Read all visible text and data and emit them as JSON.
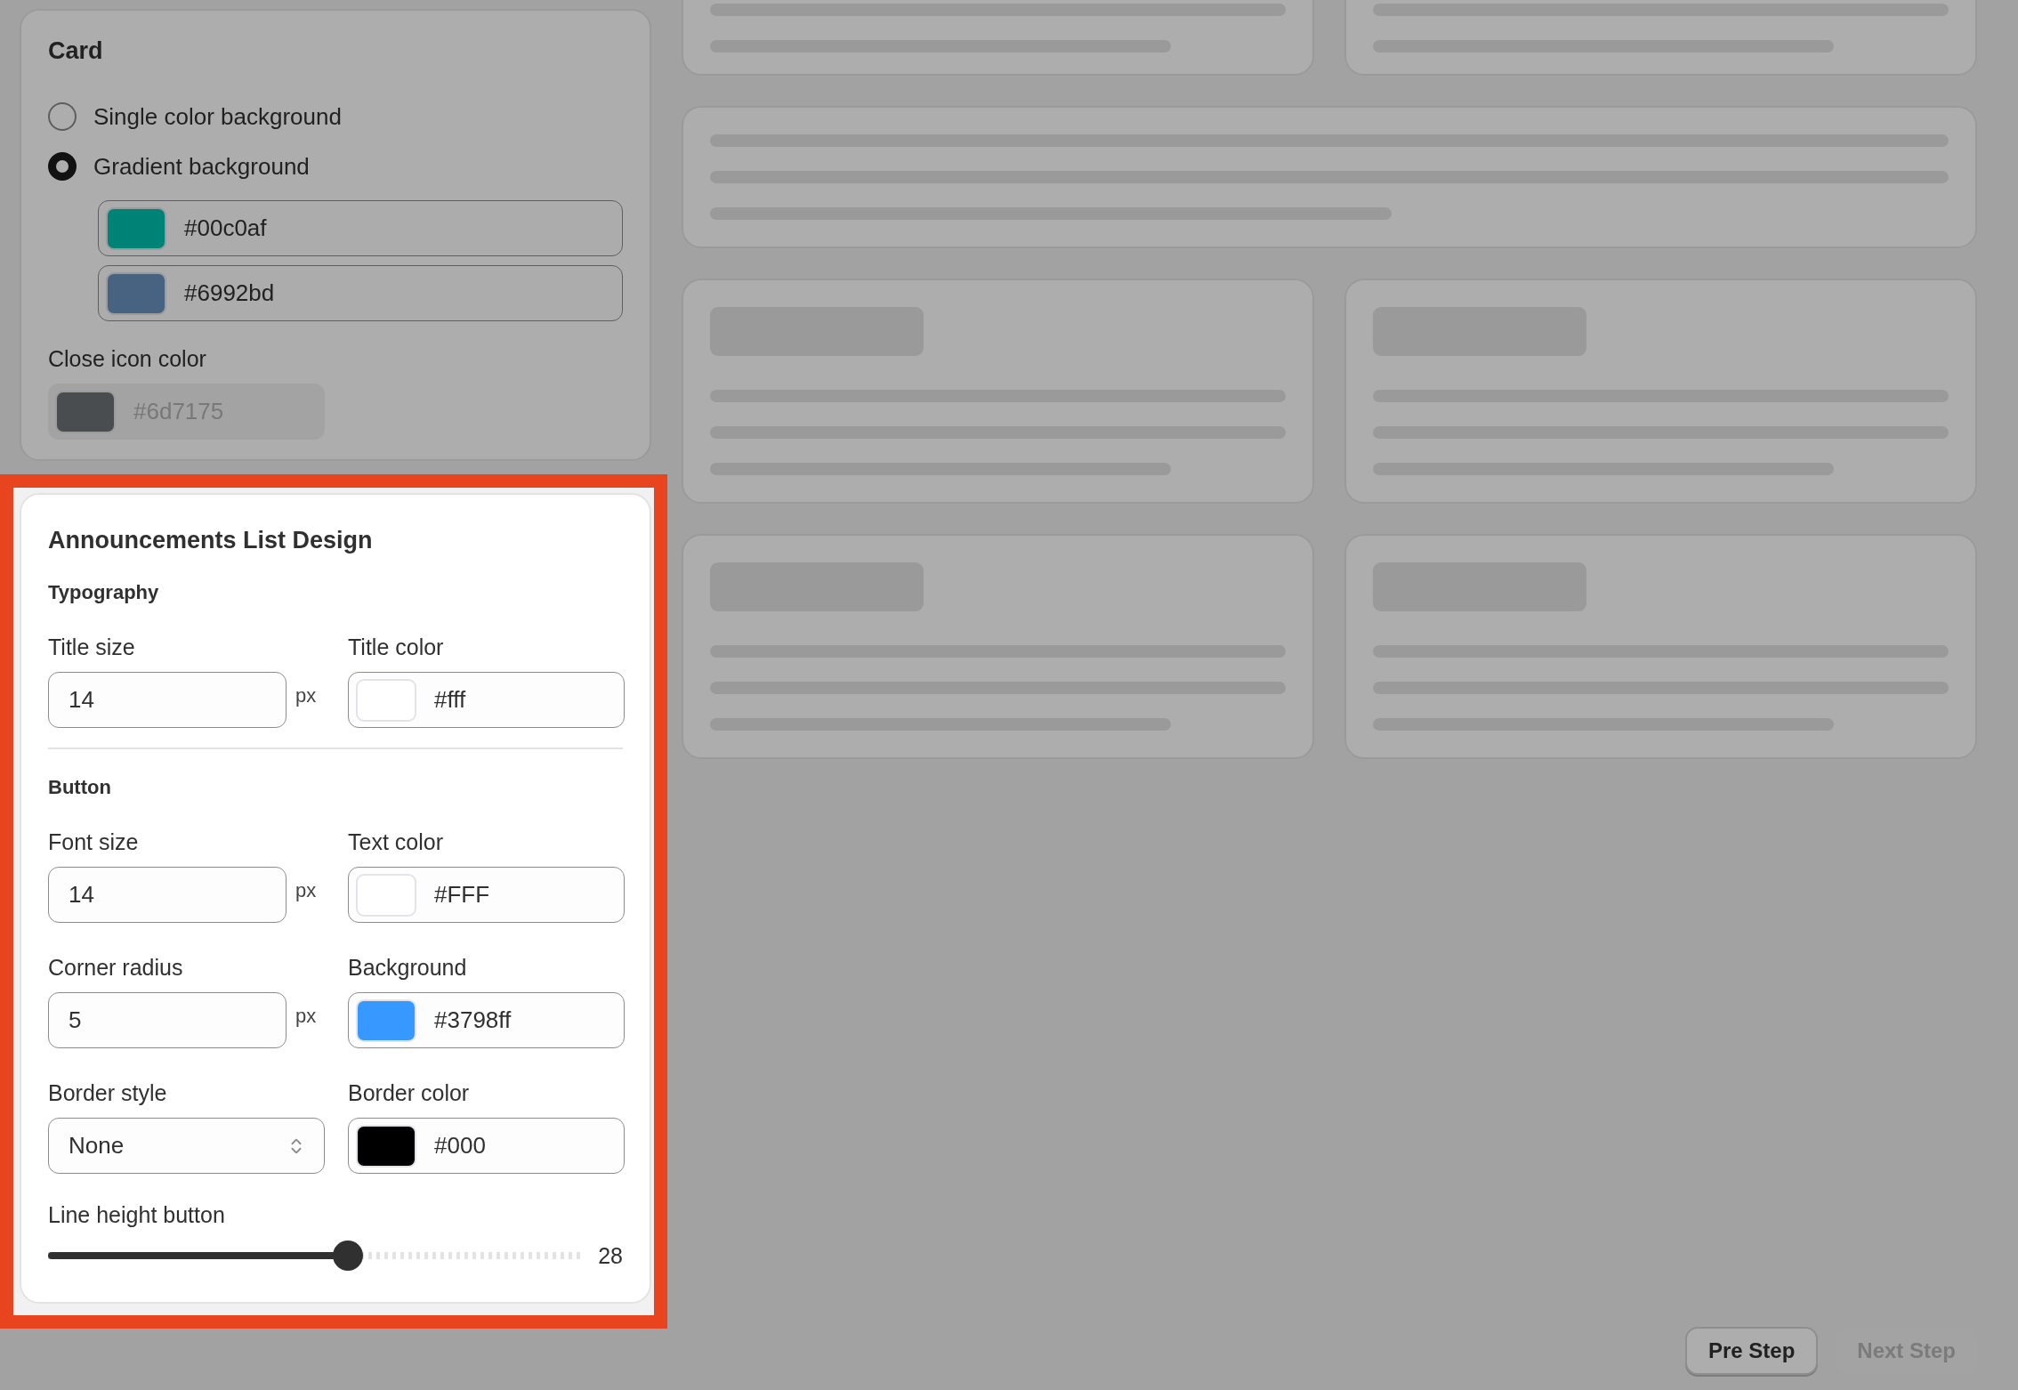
{
  "card_settings": {
    "title": "Card",
    "background_options": [
      {
        "label": "Single color background",
        "selected": false
      },
      {
        "label": "Gradient background",
        "selected": true
      }
    ],
    "gradient_colors": [
      "#00c0af",
      "#6992bd"
    ],
    "close_icon_color": {
      "label": "Close icon color",
      "value": "#6d7175",
      "disabled": true
    }
  },
  "announcements_list_design": {
    "title": "Announcements List Design",
    "sections": [
      {
        "heading": "Typography",
        "fields": [
          {
            "kind": "number",
            "label": "Title size",
            "value": "14",
            "unit": "px"
          },
          {
            "kind": "color",
            "label": "Title color",
            "value": "#fff"
          }
        ]
      },
      {
        "heading": "Button",
        "fields": [
          {
            "kind": "number",
            "label": "Font size",
            "value": "14",
            "unit": "px"
          },
          {
            "kind": "color",
            "label": "Text color",
            "value": "#FFF"
          },
          {
            "kind": "number",
            "label": "Corner radius",
            "value": "5",
            "unit": "px"
          },
          {
            "kind": "color",
            "label": "Background",
            "value": "#3798ff"
          },
          {
            "kind": "select",
            "label": "Border style",
            "value": "None"
          },
          {
            "kind": "color",
            "label": "Border color",
            "value": "#000"
          }
        ]
      }
    ],
    "slider": {
      "label": "Line height button",
      "level": 0.56,
      "reading": "28"
    }
  },
  "footer_buttons": [
    {
      "label": "Pre Step",
      "disabled": false
    },
    {
      "label": "Next Step",
      "disabled": true
    }
  ]
}
